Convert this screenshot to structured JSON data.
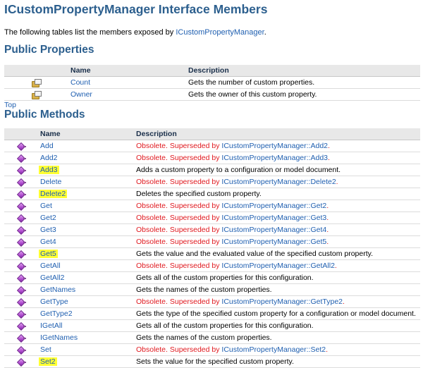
{
  "page": {
    "title": "ICustomPropertyManager Interface Members",
    "intro_text": "The following tables list the members exposed by ",
    "intro_link": "ICustomPropertyManager",
    "intro_end": ".",
    "top_link": "Top"
  },
  "properties": {
    "heading": "Public Properties",
    "col_name": "Name",
    "col_desc": "Description",
    "rows": [
      {
        "name": "Count",
        "desc": "Gets the number of custom properties."
      },
      {
        "name": "Owner",
        "desc": "Gets the owner of this custom property."
      }
    ]
  },
  "methods": {
    "heading": "Public Methods",
    "col_name": "Name",
    "col_desc": "Description",
    "obsolete_prefix": "Obsolete. Superseded by ",
    "rows": [
      {
        "name": "Add",
        "highlight": false,
        "obsolete": true,
        "desc": "",
        "ref": "ICustomPropertyManager::Add2",
        "end": "."
      },
      {
        "name": "Add2",
        "highlight": false,
        "obsolete": true,
        "desc": "",
        "ref": "ICustomPropertyManager::Add3",
        "end": "."
      },
      {
        "name": "Add3",
        "highlight": true,
        "obsolete": false,
        "desc": "Adds a custom property to a configuration or model document.",
        "ref": "",
        "end": ""
      },
      {
        "name": "Delete",
        "highlight": false,
        "obsolete": true,
        "desc": "",
        "ref": "ICustomPropertyManager::Delete2",
        "end": "."
      },
      {
        "name": "Delete2",
        "highlight": true,
        "obsolete": false,
        "desc": "Deletes the specified custom property.",
        "ref": "",
        "end": ""
      },
      {
        "name": "Get",
        "highlight": false,
        "obsolete": true,
        "desc": "",
        "ref": "ICustomPropertyManager::Get2",
        "end": "."
      },
      {
        "name": "Get2",
        "highlight": false,
        "obsolete": true,
        "desc": "",
        "ref": "ICustomPropertyManager::Get3",
        "end": "."
      },
      {
        "name": "Get3",
        "highlight": false,
        "obsolete": true,
        "desc": "",
        "ref": "ICustomPropertyManager::Get4",
        "end": "."
      },
      {
        "name": "Get4",
        "highlight": false,
        "obsolete": true,
        "desc": "",
        "ref": "ICustomPropertyManager::Get5",
        "end": "."
      },
      {
        "name": "Get5",
        "highlight": true,
        "obsolete": false,
        "desc": "Gets the value and the evaluated value of the specified custom property.",
        "ref": "",
        "end": ""
      },
      {
        "name": "GetAll",
        "highlight": false,
        "obsolete": true,
        "desc": "",
        "ref": "ICustomPropertyManager::GetAll2",
        "end": "."
      },
      {
        "name": "GetAll2",
        "highlight": false,
        "obsolete": false,
        "desc": "Gets all of the custom properties for this configuration.",
        "ref": "",
        "end": ""
      },
      {
        "name": "GetNames",
        "highlight": false,
        "obsolete": false,
        "desc": "Gets the names of the custom properties.",
        "ref": "",
        "end": ""
      },
      {
        "name": "GetType",
        "highlight": false,
        "obsolete": true,
        "desc": "",
        "ref": "ICustomPropertyManager::GetType2",
        "end": "."
      },
      {
        "name": "GetType2",
        "highlight": false,
        "obsolete": false,
        "desc": "Gets the type of the specified custom property for a configuration or model document.",
        "ref": "",
        "end": ""
      },
      {
        "name": "IGetAll",
        "highlight": false,
        "obsolete": false,
        "desc": "Gets all of the custom properties for this configuration.",
        "ref": "",
        "end": ""
      },
      {
        "name": "IGetNames",
        "highlight": false,
        "obsolete": false,
        "desc": "Gets the names of the custom properties.",
        "ref": "",
        "end": ""
      },
      {
        "name": "Set",
        "highlight": false,
        "obsolete": true,
        "desc": "",
        "ref": "ICustomPropertyManager::Set2",
        "end": "."
      },
      {
        "name": "Set2",
        "highlight": true,
        "obsolete": false,
        "desc": "Sets the value for the specified custom property.",
        "ref": "",
        "end": ""
      }
    ]
  },
  "icons": {
    "property": "property-icon",
    "method": "method-icon"
  },
  "colors": {
    "heading": "#2c5f8e",
    "link": "#1f5fb0",
    "obsolete": "#e0191f",
    "highlight": "#ffff33",
    "header_bg": "#e8e8e8"
  }
}
